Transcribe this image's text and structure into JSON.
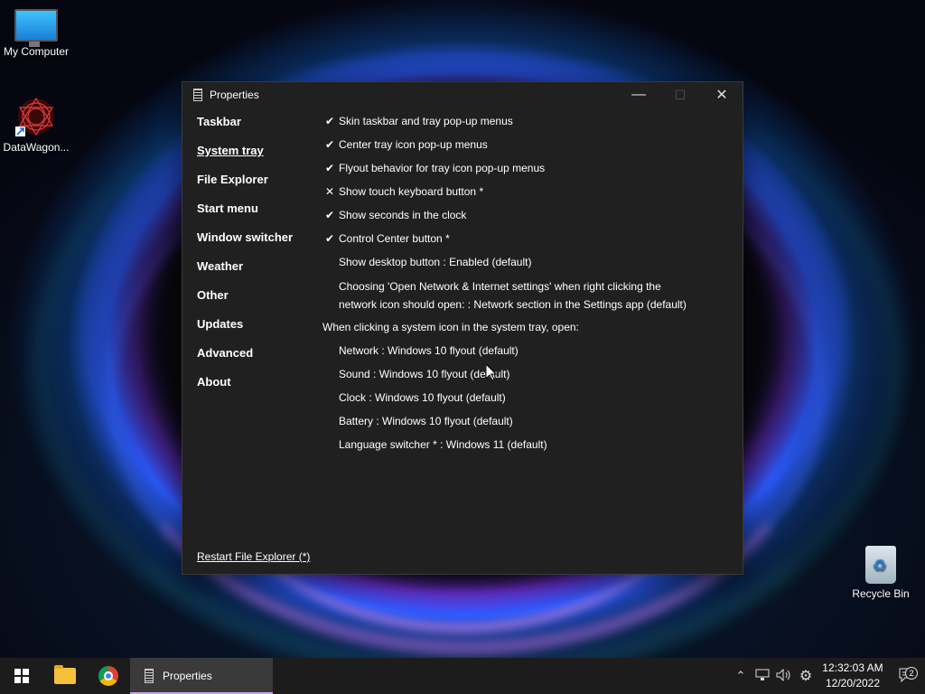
{
  "desktop": {
    "icons": [
      {
        "label": "My Computer",
        "icon": "monitor-icon"
      },
      {
        "label": "DataWagon...",
        "icon": "datawagon-icon"
      },
      {
        "label": "Recycle Bin",
        "icon": "recycle-bin-icon"
      }
    ]
  },
  "window": {
    "title": "Properties",
    "controls": {
      "minimize": "—",
      "maximize": "☐",
      "close": "✕"
    },
    "nav": [
      "Taskbar",
      "System tray",
      "File Explorer",
      "Start menu",
      "Window switcher",
      "Weather",
      "Other",
      "Updates",
      "Advanced",
      "About"
    ],
    "active_nav": "System tray",
    "options": [
      {
        "mark": "✔",
        "label": "Skin taskbar and tray pop-up menus"
      },
      {
        "mark": "✔",
        "label": "Center tray icon pop-up menus"
      },
      {
        "mark": "✔",
        "label": "Flyout behavior for tray icon pop-up menus"
      },
      {
        "mark": "✕",
        "label": "Show touch keyboard button *"
      },
      {
        "mark": "✔",
        "label": "Show seconds in the clock"
      },
      {
        "mark": "✔",
        "label": "Control Center button *"
      },
      {
        "mark": "",
        "label": "Show desktop button : Enabled (default)"
      },
      {
        "mark": "",
        "label_line1": "Choosing 'Open Network & Internet settings' when right clicking the",
        "label_line2": "network icon should open: : Network section in the Settings app (default)"
      }
    ],
    "section_heading": "When clicking a system icon in the system tray, open:",
    "flyouts": [
      "Network : Windows 10 flyout (default)",
      "Sound : Windows 10 flyout (default)",
      "Clock : Windows 10 flyout (default)",
      "Battery : Windows 10 flyout (default)",
      "Language switcher * : Windows 11 (default)"
    ],
    "footer_link": "Restart File Explorer (*)"
  },
  "taskbar": {
    "active_app": "Properties",
    "tray_icons": [
      "chevron-up-icon",
      "network-icon",
      "volume-icon",
      "gear-icon"
    ],
    "time": "12:32:03 AM",
    "date": "12/20/2022",
    "notification_count": "2"
  }
}
